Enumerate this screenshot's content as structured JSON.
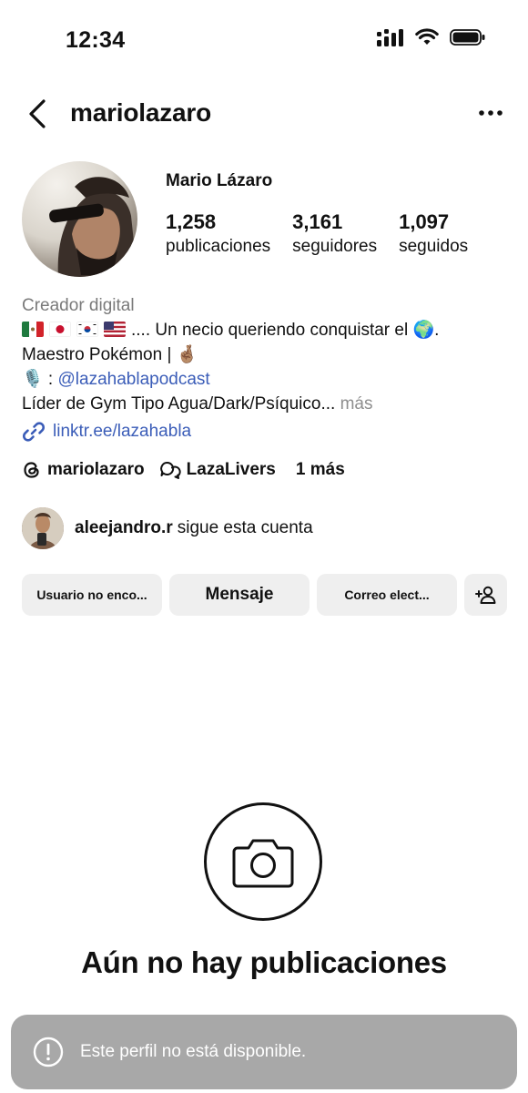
{
  "status_bar": {
    "time": "12:34"
  },
  "header": {
    "username": "mariolazaro"
  },
  "profile": {
    "display_name": "Mario Lázaro",
    "stats": [
      {
        "count": "1,258",
        "label": "publicaciones"
      },
      {
        "count": "3,161",
        "label": "seguidores"
      },
      {
        "count": "1,097",
        "label": "seguidos"
      }
    ]
  },
  "bio": {
    "category": "Creador digital",
    "line1_text": ".... Un necio queriendo conquistar el",
    "line1_emoji": "🌍.",
    "line2_text": "Maestro Pokémon |",
    "line2_emoji": "🤞🏽",
    "line3_prefix": "🎙️ :",
    "line3_mention": "@lazahablapodcast",
    "line4_text": "Líder de Gym Tipo Agua/Dark/Psíquico...",
    "line4_more": "más",
    "link": "linktr.ee/lazahabla"
  },
  "threads": {
    "username": "mariolazaro",
    "community": "LazaLivers",
    "more": "1 más"
  },
  "followed_by": {
    "name": "aleejandro.r",
    "text": "sigue esta cuenta"
  },
  "actions": {
    "button1": "Usuario no enco...",
    "button2": "Mensaje",
    "button3": "Correo elect..."
  },
  "empty_state": {
    "title": "Aún no hay publicaciones"
  },
  "toast": {
    "text": "Este perfil no está disponible."
  },
  "colors": {
    "link": "#3b5db8",
    "button_bg": "#efefef",
    "toast_bg": "#a8a8a8",
    "muted": "#7a7a7a"
  }
}
